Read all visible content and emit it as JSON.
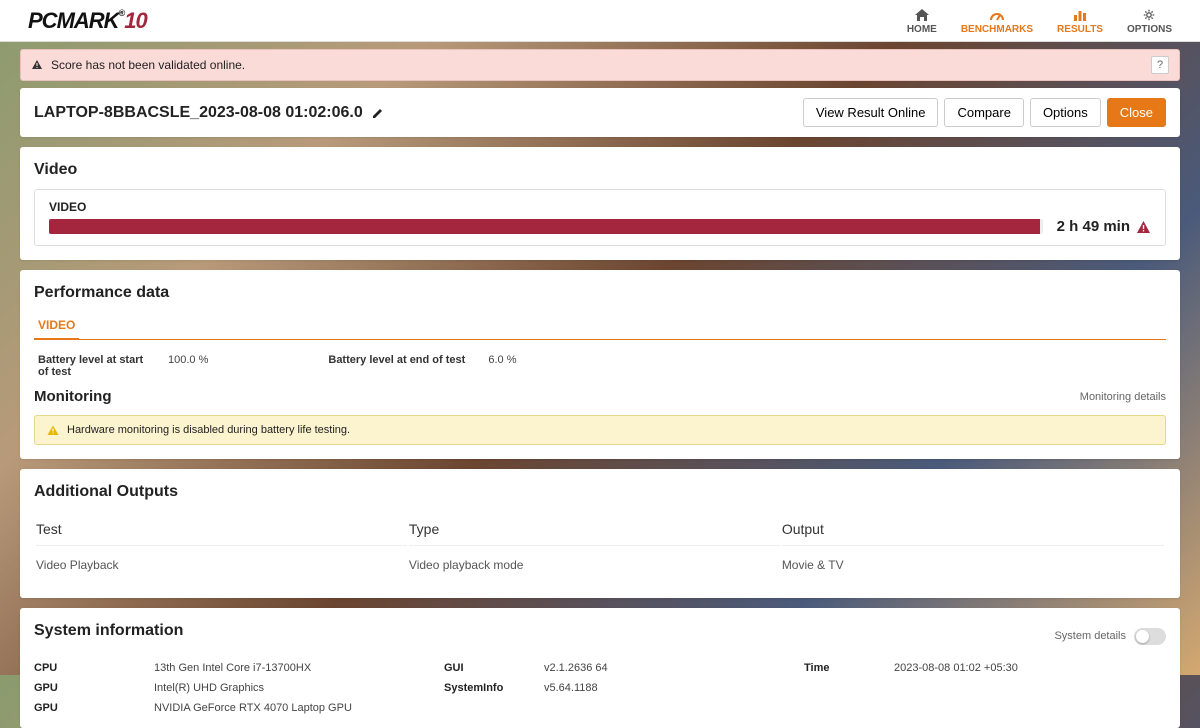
{
  "nav": {
    "home": "HOME",
    "benchmarks": "BENCHMARKS",
    "results": "RESULTS",
    "options": "OPTIONS"
  },
  "alert": {
    "text": "Score has not been validated online.",
    "help": "?"
  },
  "titlebar": {
    "title": "LAPTOP-8BBACSLE_2023-08-08 01:02:06.0",
    "buttons": {
      "view": "View Result Online",
      "compare": "Compare",
      "options": "Options",
      "close": "Close"
    }
  },
  "video": {
    "heading": "Video",
    "label": "VIDEO",
    "time": "2 h 49 min"
  },
  "perf": {
    "heading": "Performance data",
    "tab": "VIDEO",
    "batt_start_label": "Battery level at start of test",
    "batt_start_val": "100.0 %",
    "batt_end_label": "Battery level at end of test",
    "batt_end_val": "6.0 %"
  },
  "monitoring": {
    "heading": "Monitoring",
    "details": "Monitoring details",
    "warn": "Hardware monitoring is disabled during battery life testing."
  },
  "outputs": {
    "heading": "Additional Outputs",
    "col_test": "Test",
    "col_type": "Type",
    "col_output": "Output",
    "row_test": "Video Playback",
    "row_type": "Video playback mode",
    "row_output": "Movie & TV"
  },
  "sysinfo": {
    "heading": "System information",
    "details": "System details",
    "rows": {
      "cpu_k": "CPU",
      "cpu_v": "13th Gen Intel Core i7-13700HX",
      "gpu1_k": "GPU",
      "gpu1_v": "Intel(R) UHD Graphics",
      "gpu2_k": "GPU",
      "gpu2_v": "NVIDIA GeForce RTX 4070 Laptop GPU",
      "gui_k": "GUI",
      "gui_v": "v2.1.2636 64",
      "si_k": "SystemInfo",
      "si_v": "v5.64.1188",
      "time_k": "Time",
      "time_v": "2023-08-08 01:02 +05:30"
    }
  }
}
